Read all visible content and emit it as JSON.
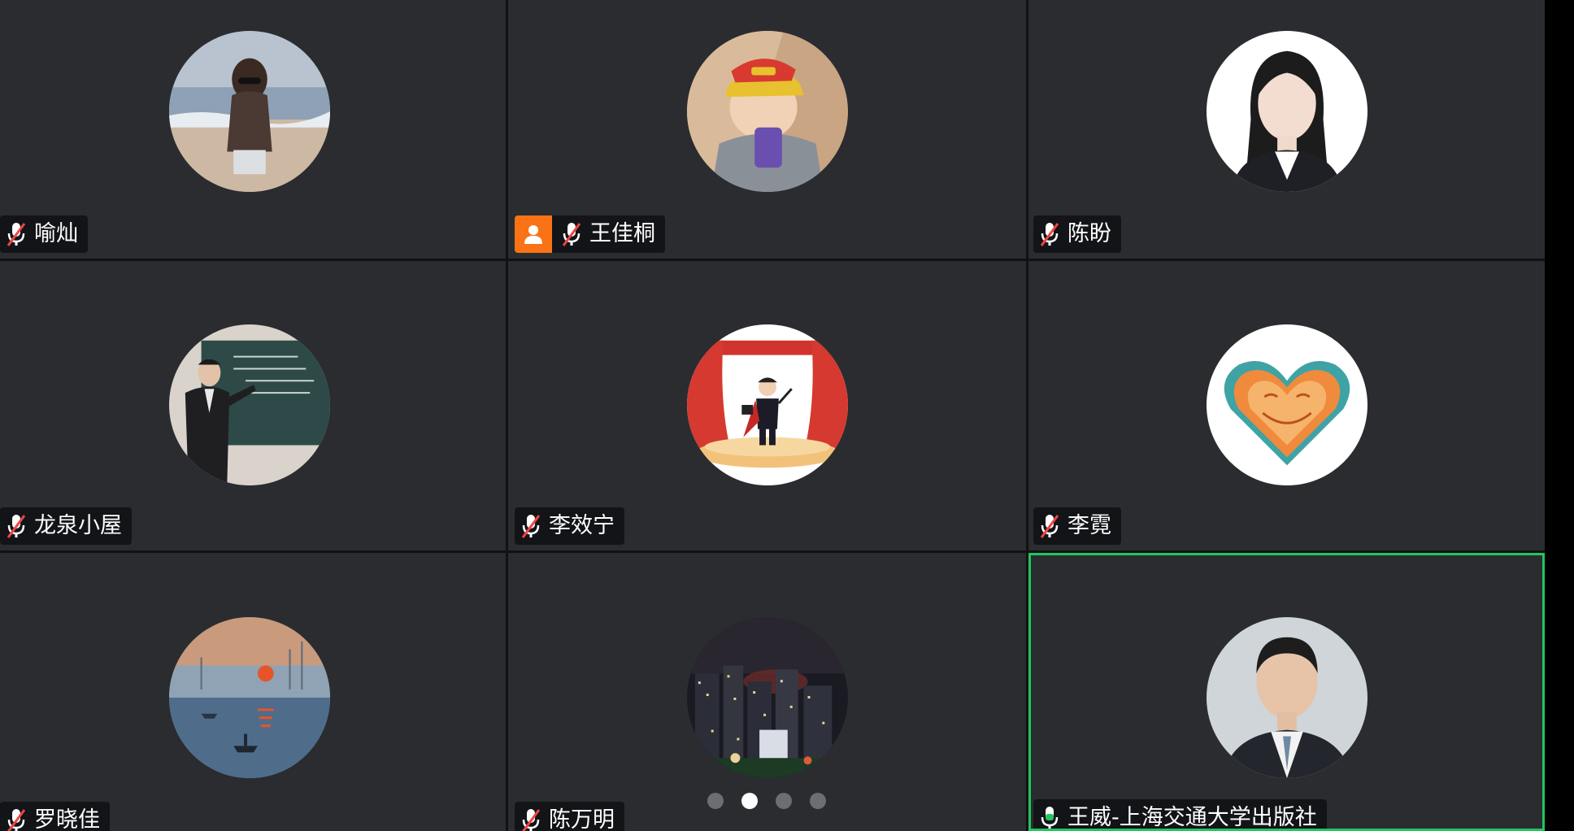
{
  "participants": [
    {
      "name": "喻灿",
      "mic": "muted",
      "avatar": "beach-photo-avatar"
    },
    {
      "name": "王佳桐",
      "mic": "muted",
      "avatar": "child-cap-photo-avatar",
      "badge": "user-icon"
    },
    {
      "name": "陈盼",
      "mic": "muted",
      "avatar": "portrait-woman-avatar"
    },
    {
      "name": "龙泉小屋",
      "mic": "muted",
      "avatar": "teacher-blackboard-avatar"
    },
    {
      "name": "李效宁",
      "mic": "muted",
      "avatar": "magician-stage-avatar"
    },
    {
      "name": "李霓",
      "mic": "muted",
      "avatar": "sun-heart-avatar"
    },
    {
      "name": "罗晓佳",
      "mic": "muted",
      "avatar": "impressionist-sunrise-avatar"
    },
    {
      "name": "陈万明",
      "mic": "muted",
      "avatar": "night-city-avatar"
    },
    {
      "name": "王威-上海交通大学出版社",
      "mic": "unmuted",
      "avatar": "portrait-man-avatar",
      "active_speaker": true
    }
  ],
  "pagination": {
    "total_pages": 4,
    "current_page": 2
  },
  "colors": {
    "tile_bg": "#2a2c30",
    "active_border": "#22c55e",
    "badge_orange": "#f97316",
    "mic_muted": "#ef4444",
    "mic_on": "#22c55e"
  }
}
